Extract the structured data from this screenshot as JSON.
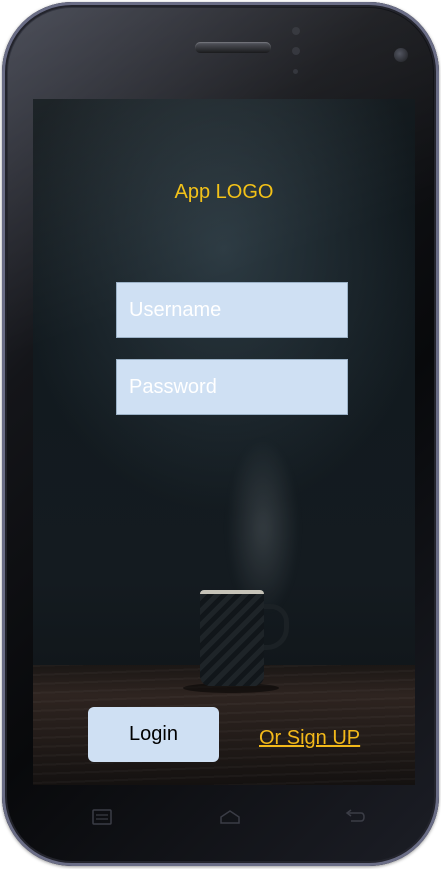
{
  "app": {
    "logo_text": "App LOGO"
  },
  "login_form": {
    "username_placeholder": "Username",
    "password_placeholder": "Password",
    "login_label": "Login",
    "signup_label": "Or Sign UP"
  },
  "nav_bar": {
    "icons": [
      "menu-icon",
      "home-icon",
      "back-icon"
    ]
  },
  "colors": {
    "accent": "#f3c012",
    "input_background": "#cfe0f3"
  }
}
